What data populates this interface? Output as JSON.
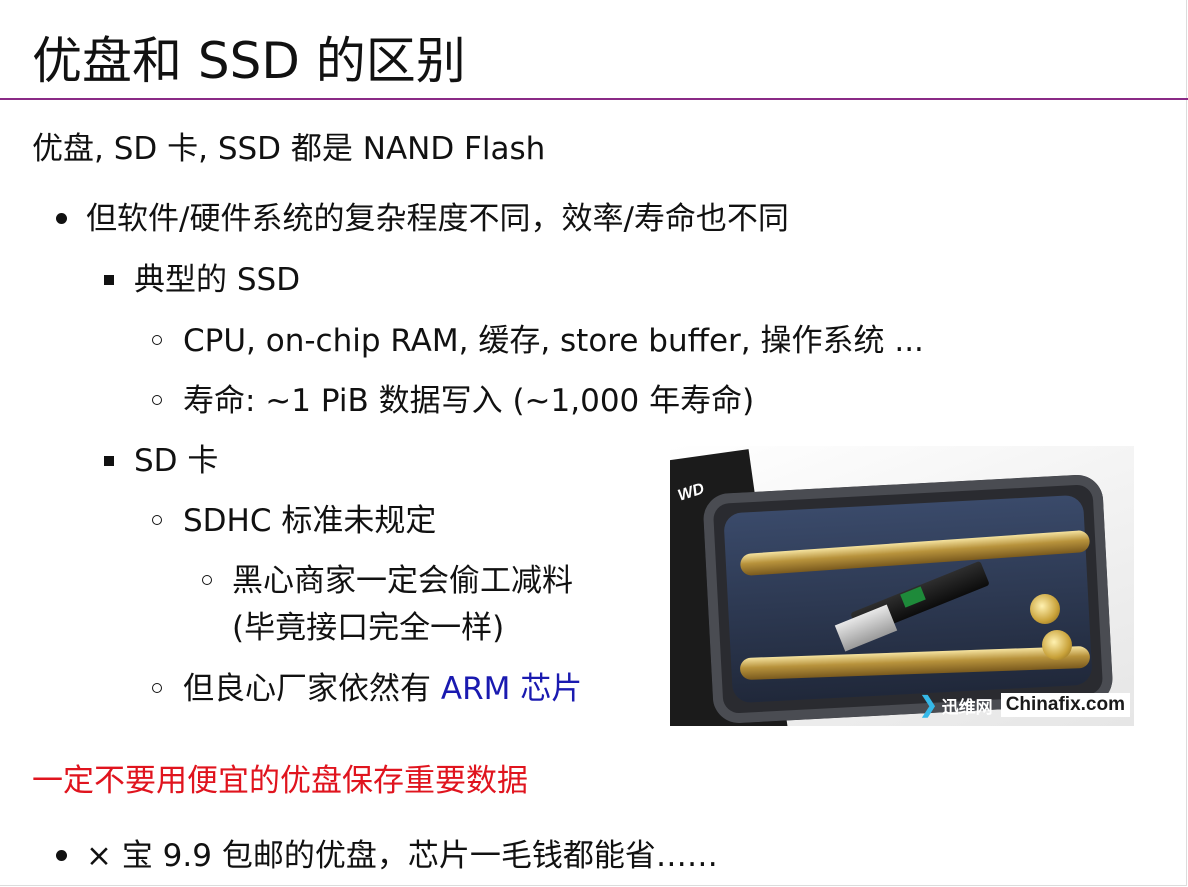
{
  "slide": {
    "title": "优盘和 SSD 的区别",
    "intro": "优盘, SD 卡, SSD 都是 NAND Flash",
    "level1_a": "但软件/硬件系统的复杂程度不同，效率/寿命也不同",
    "ssd_heading": "典型的 SSD",
    "ssd_item1": "CPU, on-chip RAM, 缓存, store buffer, 操作系统 ...",
    "ssd_item2": "寿命: ~1 PiB 数据写入 (~1,000 年寿命)",
    "sd_heading": "SD 卡",
    "sd_item1": "SDHC 标准未规定",
    "sd_item1_sub_line1": "黑心商家一定会偷工减料",
    "sd_item1_sub_line2": "(毕竟接口完全一样)",
    "sd_item2_prefix": "但良心厂家依然有 ",
    "sd_item2_link": "ARM 芯片",
    "warning": "一定不要用便宜的优盘保存重要数据",
    "level1_b": "× 宝 9.9 包邮的优盘，芯片一毛钱都能省……"
  },
  "photo": {
    "brand_text": "WD",
    "watermark_cn": "迅维网",
    "watermark_en": "Chinafix.com"
  },
  "colors": {
    "title_rule": "#8a2a86",
    "warning": "#e0141e",
    "link": "#1a1ab0"
  }
}
